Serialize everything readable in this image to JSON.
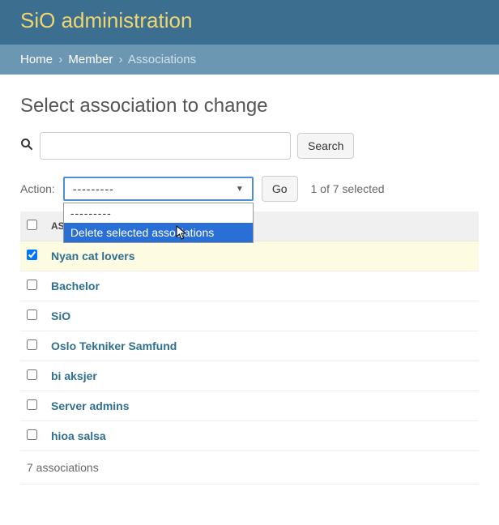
{
  "branding": {
    "site_title": "SiO administration"
  },
  "breadcrumb": {
    "home": "Home",
    "member": "Member",
    "current": "Associations"
  },
  "page": {
    "title": "Select association to change"
  },
  "search": {
    "button": "Search",
    "value": ""
  },
  "actions": {
    "label": "Action:",
    "selected_display": "---------",
    "options": {
      "blank": "---------",
      "delete": "Delete selected associations"
    },
    "go": "Go",
    "selection_info": "1 of 7 selected"
  },
  "table": {
    "header_col": "ASO",
    "rows": [
      {
        "name": "Nyan cat lovers",
        "checked": true
      },
      {
        "name": "Bachelor",
        "checked": false
      },
      {
        "name": "SiO",
        "checked": false
      },
      {
        "name": "Oslo Tekniker Samfund",
        "checked": false
      },
      {
        "name": "bi aksjer",
        "checked": false
      },
      {
        "name": "Server admins",
        "checked": false
      },
      {
        "name": "hioa salsa",
        "checked": false
      }
    ],
    "summary": "7 associations"
  }
}
